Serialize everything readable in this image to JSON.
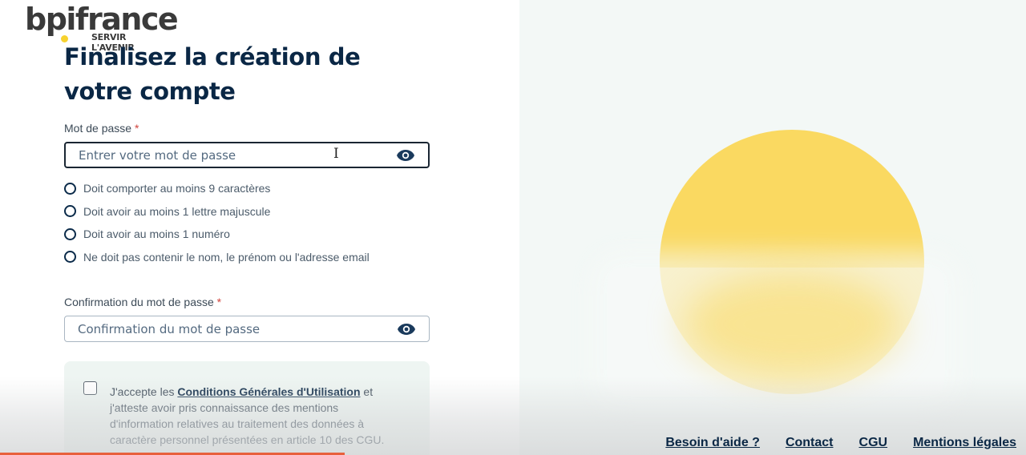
{
  "logo": {
    "brand": "bpifrance",
    "tagline": "SERVIR L'AVENIR"
  },
  "form": {
    "title": "Finalisez la création de votre compte",
    "password": {
      "label": "Mot de passe",
      "required_mark": "*",
      "placeholder": "Entrer votre mot de passe",
      "value": ""
    },
    "rules": [
      {
        "text": "Doit comporter au moins 9 caractères"
      },
      {
        "text": "Doit avoir au moins 1 lettre majuscule"
      },
      {
        "text": "Doit avoir au moins 1 numéro"
      },
      {
        "text": "Ne doit pas contenir le nom, le prénom ou l'adresse email"
      }
    ],
    "confirm": {
      "label": "Confirmation du mot de passe",
      "required_mark": "*",
      "placeholder": "Confirmation du mot de passe",
      "value": ""
    },
    "cgu": {
      "checked": false,
      "prefix": "J'accepte les ",
      "link": "Conditions Générales d'Utilisation",
      "suffix": " et j'atteste avoir pris connaissance des mentions d'information relatives au traitement des données à caractère personnel présentées en article 10 des CGU."
    }
  },
  "footer": {
    "links": [
      "Besoin d'aide ?",
      "Contact",
      "CGU",
      "Mentions légales"
    ]
  },
  "colors": {
    "brand_yellow": "#fad961",
    "title_navy": "#0a2745",
    "required_red": "#d0433b",
    "panel_bg": "#f3f8f6"
  },
  "icons": [
    "eye-icon",
    "text-cursor-icon"
  ]
}
